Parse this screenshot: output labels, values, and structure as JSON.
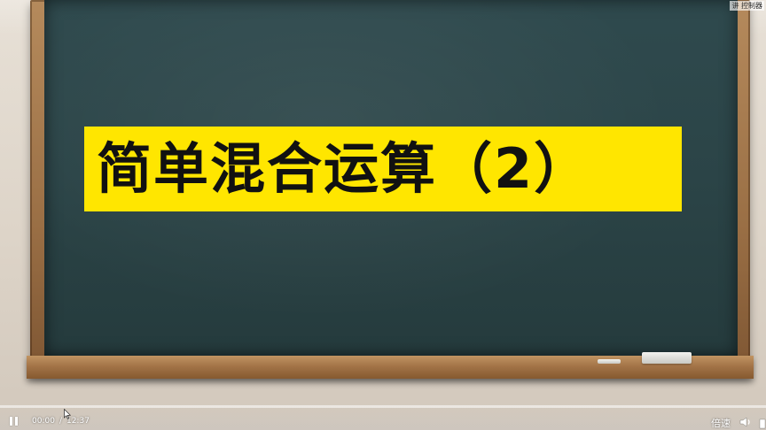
{
  "video": {
    "title": "简单混合运算（2）",
    "overlay_tag": "讲 控制器",
    "colors": {
      "banner": "#ffe600",
      "board": "#2b4447",
      "progress": "#2f8cff"
    }
  },
  "controls": {
    "current_time": "00:00",
    "separator": "/",
    "duration": "12:37",
    "speed_label": "倍速",
    "progress_fraction": 0.0,
    "icons": {
      "play": "pause-icon",
      "volume": "volume-icon",
      "fullscreen": "fullscreen-icon",
      "cursor": "mouse-cursor-icon"
    }
  }
}
